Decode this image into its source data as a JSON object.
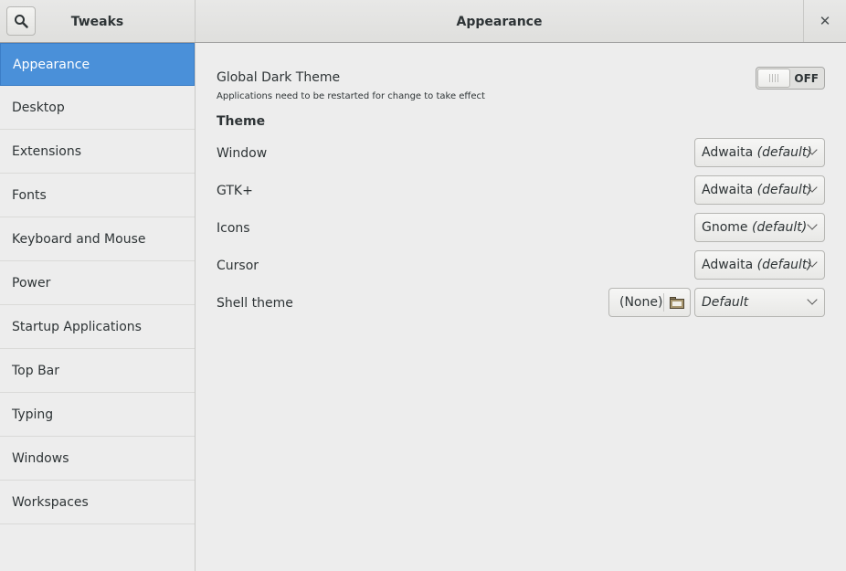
{
  "header": {
    "app_title": "Tweaks",
    "page_title": "Appearance",
    "close_glyph": "✕"
  },
  "sidebar": {
    "items": [
      {
        "label": "Appearance",
        "selected": true
      },
      {
        "label": "Desktop"
      },
      {
        "label": "Extensions"
      },
      {
        "label": "Fonts"
      },
      {
        "label": "Keyboard and Mouse"
      },
      {
        "label": "Power"
      },
      {
        "label": "Startup Applications"
      },
      {
        "label": "Top Bar"
      },
      {
        "label": "Typing"
      },
      {
        "label": "Windows"
      },
      {
        "label": "Workspaces"
      }
    ]
  },
  "main": {
    "dark_theme": {
      "label": "Global Dark Theme",
      "note": "Applications need to be restarted for change to take effect",
      "state": "OFF"
    },
    "theme_section": "Theme",
    "rows": [
      {
        "label": "Window",
        "value": "Adwaita",
        "suffix": "(default)"
      },
      {
        "label": "GTK+",
        "value": "Adwaita",
        "suffix": "(default)"
      },
      {
        "label": "Icons",
        "value": "Gnome",
        "suffix": "(default)"
      },
      {
        "label": "Cursor",
        "value": "Adwaita",
        "suffix": "(default)"
      }
    ],
    "shell": {
      "label": "Shell theme",
      "file_value": "(None)",
      "value": "Default"
    }
  },
  "colors": {
    "accent": "#4a90d9",
    "background": "#ededed"
  }
}
